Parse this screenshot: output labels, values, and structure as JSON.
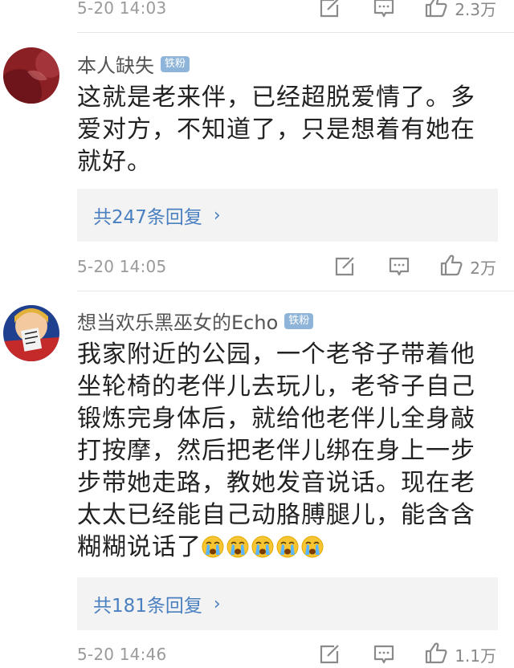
{
  "comments": [
    {
      "time": "5-20 14:03",
      "likes": "2.3万"
    },
    {
      "username": "本人缺失",
      "badge": "铁粉",
      "text": "这就是老来伴，已经超脱爱情了。多爱对方，不知道了，只是想着有她在就好。",
      "replies": "共247条回复",
      "chevron": "›",
      "time": "5-20 14:05",
      "likes": "2万"
    },
    {
      "username": "想当欢乐黑巫女的Echo",
      "badge": "铁粉",
      "text": "我家附近的公园，一个老爷子带着他坐轮椅的老伴儿去玩儿，老爷子自己锻炼完身体后，就给他老伴儿全身敲打按摩，然后把老伴儿绑在身上一步步带她走路，教她发音说话。现在老太太已经能自己动胳膊腿儿，能含含糊糊说话了",
      "emoji": [
        "crying-face",
        "crying-face",
        "crying-face",
        "crying-face",
        "crying-face"
      ],
      "replies": "共181条回复",
      "chevron": "›",
      "time": "5-20 14:46",
      "likes": "1.1万"
    }
  ],
  "icons": {
    "edit": "edit-icon",
    "comment": "comment-icon",
    "like": "thumbs-up-icon"
  },
  "colors": {
    "link": "#4a7fc0",
    "badge": "#8fb4d9",
    "meta": "#9a9a9a",
    "reply_bg": "#f3f3f3"
  }
}
